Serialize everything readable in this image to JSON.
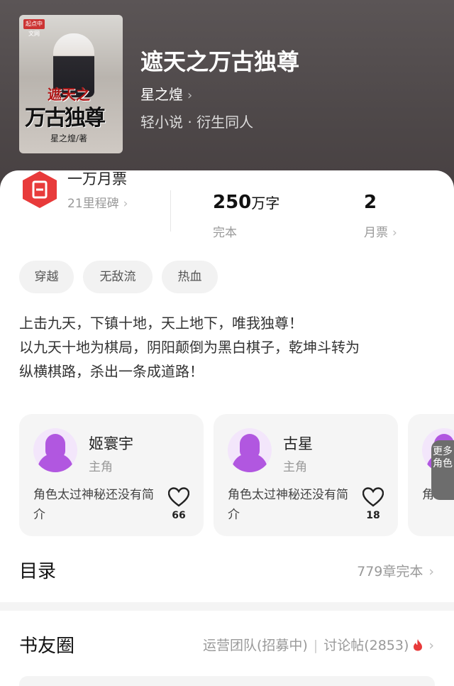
{
  "book": {
    "title": "遮天之万古独尊",
    "author": "星之煌",
    "genre": "轻小说 · 衍生同人",
    "cover": {
      "title_line1": "遮天之",
      "title_line2": "万古独尊",
      "author_credit": "星之煌/著",
      "badge": "起点中文网"
    }
  },
  "stats": {
    "ticket_title": "一万月票",
    "ticket_sub": "21里程碑",
    "words_num": "250",
    "words_unit": "万字",
    "words_status": "完本",
    "votes": "2",
    "votes_label": "月票"
  },
  "tags": [
    "穿越",
    "无敌流",
    "热血"
  ],
  "intro": [
    "上击九天，下镇十地，天上地下，唯我独尊！",
    "以九天十地为棋局，阴阳颠倒为黑白棋子，乾坤斗转为",
    "纵横棋路，杀出一条成道路！"
  ],
  "characters": [
    {
      "name": "姬寰宇",
      "role": "主角",
      "desc": "角色太过神秘还没有简介",
      "likes": "66"
    },
    {
      "name": "古星",
      "role": "主角",
      "desc": "角色太过神秘还没有简介",
      "likes": "18"
    },
    {
      "name": "",
      "role": "",
      "desc": "角色太过神秘还没有简介",
      "likes": ""
    }
  ],
  "more_roles": "更多角色",
  "toc": {
    "title": "目录",
    "info": "779章完本"
  },
  "circle": {
    "title": "书友圈",
    "team": "运营团队(招募中)",
    "posts": "讨论帖(2853)"
  },
  "colors": {
    "accent_red": "#e83a3a",
    "avatar_purple": "#b157e0"
  }
}
